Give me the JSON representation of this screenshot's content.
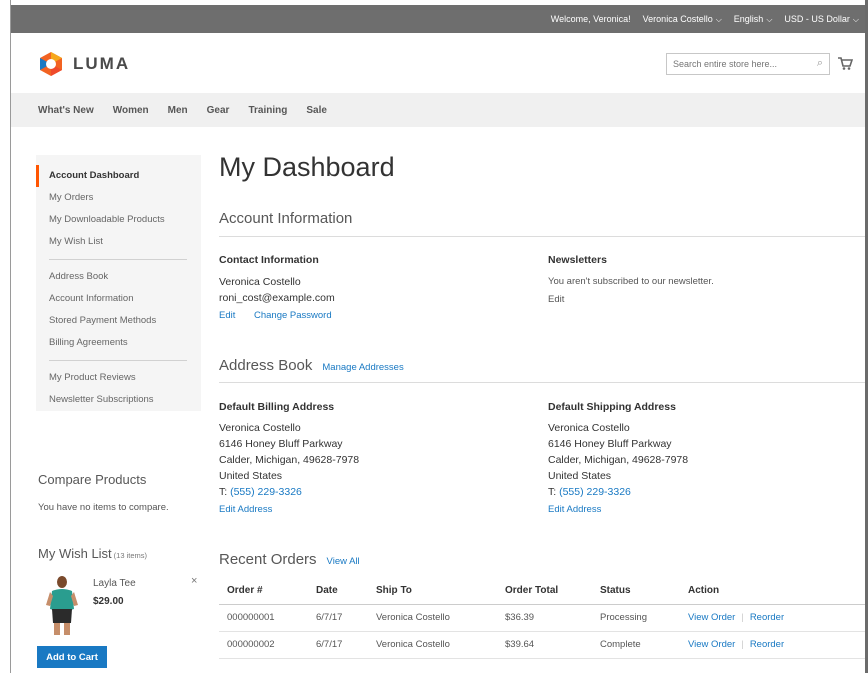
{
  "panel": {
    "welcome": "Welcome, Veronica!",
    "customer": "Veronica Costello",
    "language": "English",
    "currency": "USD - US Dollar"
  },
  "header": {
    "logo_text": "LUMA",
    "search_placeholder": "Search entire store here..."
  },
  "nav": {
    "items": [
      "What's New",
      "Women",
      "Men",
      "Gear",
      "Training",
      "Sale"
    ]
  },
  "sidebar": {
    "group1": [
      "Account Dashboard",
      "My Orders",
      "My Downloadable Products",
      "My Wish List"
    ],
    "group2": [
      "Address Book",
      "Account Information",
      "Stored Payment Methods",
      "Billing Agreements"
    ],
    "group3": [
      "My Product Reviews",
      "Newsletter Subscriptions"
    ]
  },
  "compare": {
    "title": "Compare Products",
    "empty": "You have no items to compare."
  },
  "wishlist": {
    "title": "My Wish List",
    "count": "(13 items)",
    "item_name": "Layla Tee",
    "item_price": "$29.00",
    "remove": "×",
    "add_to_cart": "Add to Cart"
  },
  "main": {
    "page_title": "My Dashboard",
    "account_info": {
      "title": "Account Information",
      "contact": {
        "title": "Contact Information",
        "name": "Veronica Costello",
        "email": "roni_cost@example.com",
        "edit": "Edit",
        "change_password": "Change Password"
      },
      "newsletters": {
        "title": "Newsletters",
        "text": "You aren't subscribed to our newsletter.",
        "edit": "Edit"
      }
    },
    "address_book": {
      "title": "Address Book",
      "manage": "Manage Addresses",
      "billing": {
        "title": "Default Billing Address",
        "name": "Veronica Costello",
        "street": "6146 Honey Bluff Parkway",
        "city": "Calder, Michigan, 49628-7978",
        "country": "United States",
        "phone_prefix": "T: ",
        "phone": "(555) 229-3326",
        "edit": "Edit Address"
      },
      "shipping": {
        "title": "Default Shipping Address",
        "name": "Veronica Costello",
        "street": "6146 Honey Bluff Parkway",
        "city": "Calder, Michigan, 49628-7978",
        "country": "United States",
        "phone_prefix": "T: ",
        "phone": "(555) 229-3326",
        "edit": "Edit Address"
      }
    },
    "recent_orders": {
      "title": "Recent Orders",
      "view_all": "View All",
      "columns": [
        "Order #",
        "Date",
        "Ship To",
        "Order Total",
        "Status",
        "Action"
      ],
      "rows": [
        {
          "order": "000000001",
          "date": "6/7/17",
          "ship_to": "Veronica Costello",
          "total": "$36.39",
          "status": "Processing",
          "view": "View Order",
          "reorder": "Reorder"
        },
        {
          "order": "000000002",
          "date": "6/7/17",
          "ship_to": "Veronica Costello",
          "total": "$39.64",
          "status": "Complete",
          "view": "View Order",
          "reorder": "Reorder"
        }
      ]
    }
  },
  "colors": {
    "accent_link": "#1979c3",
    "active_marker": "#ff5501",
    "panel_bg": "#6e6e6e"
  }
}
